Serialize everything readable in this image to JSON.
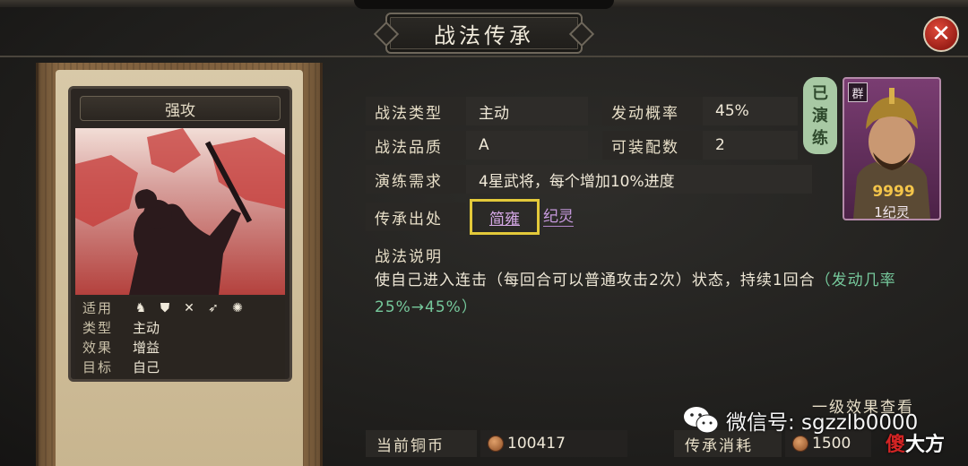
{
  "window": {
    "title": "战法传承",
    "close_icon": "close-icon"
  },
  "card": {
    "name": "强攻",
    "suitable_label": "适用",
    "troop_icons": [
      "cavalry-icon",
      "shield-icon",
      "bow-icon",
      "spear-icon",
      "wheel-icon"
    ],
    "type_label": "类型",
    "type_value": "主动",
    "effect_label": "效果",
    "effect_value": "增益",
    "target_label": "目标",
    "target_value": "自己"
  },
  "fields": {
    "tactic_type_label": "战法类型",
    "tactic_type_value": "主动",
    "trigger_rate_label": "发动概率",
    "trigger_rate_value": "45%",
    "quality_label": "战法品质",
    "quality_value": "A",
    "equip_count_label": "可装配数",
    "equip_count_value": "2",
    "drill_req_label": "演练需求",
    "drill_req_value": "4星武将，每个增加10%进度",
    "origin_label": "传承出处",
    "origin_values": [
      "简雍",
      "纪灵"
    ]
  },
  "stamp": {
    "line1": "已",
    "line2": "演",
    "line3": "练"
  },
  "portrait": {
    "faction_tag": "群",
    "stars": "9999",
    "name": "1纪灵"
  },
  "description": {
    "title": "战法说明",
    "text": "使自己进入连击（每回合可以普通攻击2次）状态，持续1回合",
    "highlight": "（发动几率25%→45%）"
  },
  "effect_link": "一级效果查看",
  "bottom": {
    "copper_label": "当前铜币",
    "copper_value": "100417",
    "cost_label": "传承消耗",
    "cost_value": "1500"
  },
  "watermark": {
    "text": "微信号: sgzzlb0000",
    "brand_first": "傻",
    "brand_rest": "大方"
  },
  "colors": {
    "accent_gold": "#e3c93a",
    "origin_purple": "#d5a8e6",
    "highlight_green": "#76c99c",
    "close_red": "#c0362a"
  }
}
